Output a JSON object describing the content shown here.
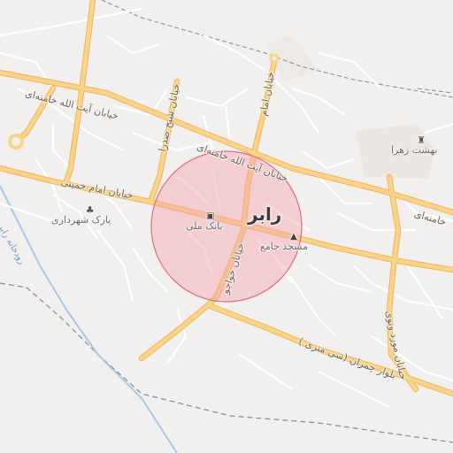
{
  "map": {
    "city_label": "رابر",
    "colors": {
      "background": "#f2f0ee",
      "major_road": "#fcd385",
      "major_road_casing": "#e8b663",
      "minor_road": "#ffffff",
      "highlight_fill": "#f5a3ad",
      "highlight_stroke": "#e56b7b",
      "river": "#a7c8ea",
      "boundary": "#8a8a8a",
      "park": "#e6ecdc"
    },
    "streets": [
      "خیابان آیت الله خامنه‌ای",
      "خیابان آیت الله خامنه‌ای",
      "خامنه‌ای",
      "خیابان امام خمینی",
      "خیابان شیخ صدرا",
      "خیابان امام",
      "خیابان خواجو",
      "بلوار چمران (سی متری )",
      "خیابان مورد ونوی"
    ],
    "pois": [
      {
        "label": "بانک ملی",
        "icon": "bank-icon"
      },
      {
        "label": "مسجد جامع",
        "icon": "mosque-icon"
      },
      {
        "label": "پارک شهرداری",
        "icon": "tree-icon"
      },
      {
        "label": "بهشت زهرا",
        "icon": "cemetery-icon"
      }
    ],
    "river_label": "رودخانه رابر"
  }
}
